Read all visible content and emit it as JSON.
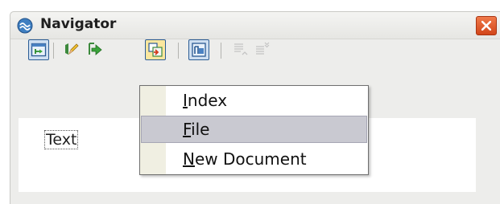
{
  "window": {
    "title": "Navigator"
  },
  "toolbar": {
    "buttons": [
      {
        "icon": "toggle-content-view-icon",
        "state": "pressed"
      },
      {
        "icon": "edit-pencil-icon",
        "state": "normal"
      },
      {
        "icon": "navigation-arrow-icon",
        "state": "normal"
      },
      {
        "icon": "drag-mode-icon",
        "state": "active"
      },
      {
        "icon": "document-list-icon",
        "state": "pressed"
      },
      {
        "icon": "promote-level-icon",
        "state": "disabled"
      },
      {
        "icon": "demote-level-icon",
        "state": "disabled"
      }
    ]
  },
  "tree": {
    "item": "Text"
  },
  "menu": {
    "items": [
      {
        "label": "Index",
        "highlighted": false
      },
      {
        "label": "File",
        "highlighted": true
      },
      {
        "label": "New Document",
        "highlighted": false
      }
    ]
  },
  "colors": {
    "window_bg": "#ededeb",
    "menu_highlight": "#c9c9d1",
    "close_button": "#e05a28",
    "pressed_button": "#cfdff1",
    "active_button": "#fbe79e"
  }
}
